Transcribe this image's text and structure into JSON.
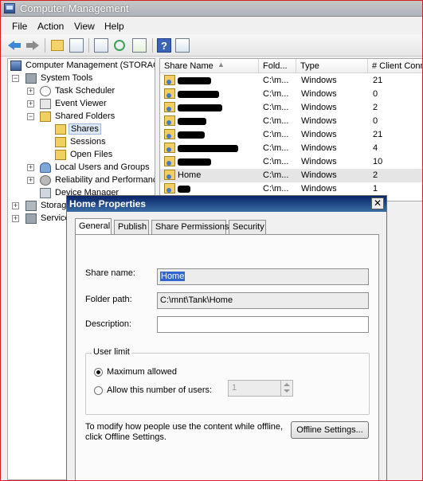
{
  "window": {
    "title": "Computer Management"
  },
  "menu": [
    "File",
    "Action",
    "View",
    "Help"
  ],
  "toolbar": {
    "icons": [
      "back-icon",
      "forward-icon",
      "up-folder-icon",
      "show-hide-tree-icon",
      "properties-icon",
      "refresh-icon",
      "export-icon",
      "help-icon",
      "show-hide-action-pane-icon"
    ]
  },
  "tree": {
    "root": "Computer Management (STORAGE",
    "system_tools": "System Tools",
    "task_scheduler": "Task Scheduler",
    "event_viewer": "Event Viewer",
    "shared_folders": "Shared Folders",
    "shares": "Shares",
    "sessions": "Sessions",
    "open_files": "Open Files",
    "local_users": "Local Users and Groups",
    "reliability": "Reliability and Performanc",
    "device_manager": "Device Manager",
    "storage": "Storag",
    "services": "Service"
  },
  "list": {
    "columns": [
      "Share Name",
      "Fold...",
      "Type",
      "# Client Conn"
    ],
    "rows": [
      {
        "name": "",
        "folder": "C:\\m...",
        "type": "Windows",
        "clients": "21"
      },
      {
        "name": "",
        "folder": "C:\\m...",
        "type": "Windows",
        "clients": "0"
      },
      {
        "name": "",
        "folder": "C:\\m...",
        "type": "Windows",
        "clients": "2"
      },
      {
        "name": "",
        "folder": "C:\\m...",
        "type": "Windows",
        "clients": "0"
      },
      {
        "name": "",
        "folder": "C:\\m...",
        "type": "Windows",
        "clients": "21"
      },
      {
        "name": "",
        "folder": "C:\\m...",
        "type": "Windows",
        "clients": "4"
      },
      {
        "name": "",
        "folder": "C:\\m...",
        "type": "Windows",
        "clients": "10"
      },
      {
        "name": "Home",
        "folder": "C:\\m...",
        "type": "Windows",
        "clients": "2"
      },
      {
        "name": "",
        "folder": "C:\\m...",
        "type": "Windows",
        "clients": "1"
      }
    ]
  },
  "dialog": {
    "title": "Home Properties",
    "close": "✕",
    "tabs": [
      "General",
      "Publish",
      "Share Permissions",
      "Security"
    ],
    "share_name_label": "Share name:",
    "share_name_value": "Home",
    "folder_path_label": "Folder path:",
    "folder_path_value": "C:\\mnt\\Tank\\Home",
    "description_label": "Description:",
    "description_value": "",
    "user_limit_label": "User limit",
    "max_allowed_label": "Maximum allowed",
    "allow_number_label": "Allow this number of users:",
    "allow_number_value": "1",
    "offline_text_line1": "To modify how people use the content while offline,",
    "offline_text_line2": "click Offline Settings.",
    "offline_button": "Offline Settings..."
  }
}
